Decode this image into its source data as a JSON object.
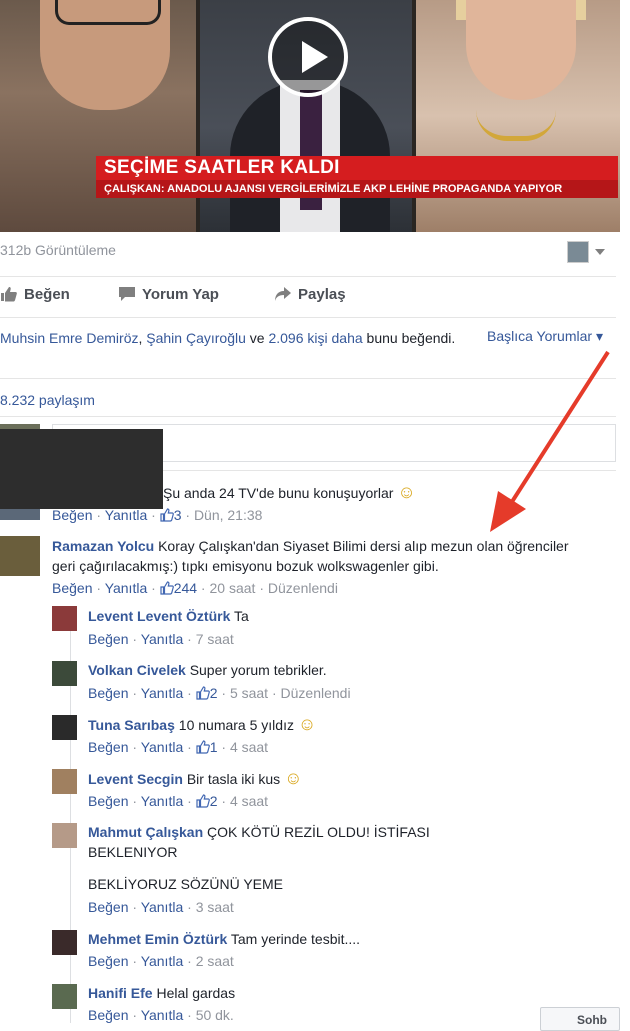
{
  "video": {
    "headline": "SEÇİME SAATLER KALDI",
    "ticker": "ÇALIŞKAN: ANADOLU AJANSI VERGİLERİMİZLE AKP LEHİNE PROPAGANDA YAPIYOR"
  },
  "post": {
    "views": "312b Görüntüleme",
    "actions": {
      "like": "Beğen",
      "comment": "Yorum Yap",
      "share": "Paylaş"
    },
    "likes": {
      "name1": "Muhsin Emre Demiröz",
      "sep": ",",
      "name2": "Şahin Çayıroğlu",
      "and": " ve ",
      "others": "2.096 kişi daha",
      "suffix": " bunu beğendi."
    },
    "top_comments": "Başlıca Yorumlar",
    "shares": "8.232 paylaşım"
  },
  "comments": {
    "c0": {
      "text": "Şu anda 24 TV'de bunu konuşuyorlar",
      "emoji": "☺",
      "like": "Beğen",
      "reply": "Yanıtla",
      "count": "3",
      "time": "Dün, 21:38"
    },
    "c1": {
      "name": "Ramazan Yolcu",
      "text": "Koray Çalışkan'dan Siyaset Bilimi dersi alıp mezun olan öğrenciler geri çağırılacakmış:) tıpkı emisyonu bozuk wolkswagenler gibi.",
      "like": "Beğen",
      "reply": "Yanıtla",
      "count": "244",
      "time": "20 saat",
      "edited": "Düzenlendi"
    },
    "r1": {
      "name": "Levent Levent Öztürk",
      "text": "Ta",
      "like": "Beğen",
      "reply": "Yanıtla",
      "time": "7 saat"
    },
    "r2": {
      "name": "Volkan Civelek",
      "text": "Super yorum tebrikler.",
      "like": "Beğen",
      "reply": "Yanıtla",
      "count": "2",
      "time": "5 saat",
      "edited": "Düzenlendi"
    },
    "r3": {
      "name": "Tuna Sarıbaş",
      "text": "10 numara 5 yıldız",
      "emoji": "☺",
      "like": "Beğen",
      "reply": "Yanıtla",
      "count": "1",
      "time": "4 saat"
    },
    "r4": {
      "name": "Levent Secgin",
      "text": "Bir tasla iki kus",
      "emoji": "☺",
      "like": "Beğen",
      "reply": "Yanıtla",
      "count": "2",
      "time": "4 saat"
    },
    "r5": {
      "name": "Mahmut Çalışkan",
      "text": "ÇOK KÖTÜ REZİL OLDU! İSTİFASI BEKLENIYOR",
      "text2": "BEKLİYORUZ SÖZÜNÜ YEME",
      "like": "Beğen",
      "reply": "Yanıtla",
      "time": "3 saat"
    },
    "r6": {
      "name": "Mehmet Emin Öztürk",
      "text": "Tam yerinde tesbit....",
      "like": "Beğen",
      "reply": "Yanıtla",
      "time": "2 saat"
    },
    "r7": {
      "name": "Hanifi Efe",
      "text": "Helal gardas",
      "like": "Beğen",
      "reply": "Yanıtla",
      "time": "50 dk."
    }
  },
  "more_button": "Sohb"
}
